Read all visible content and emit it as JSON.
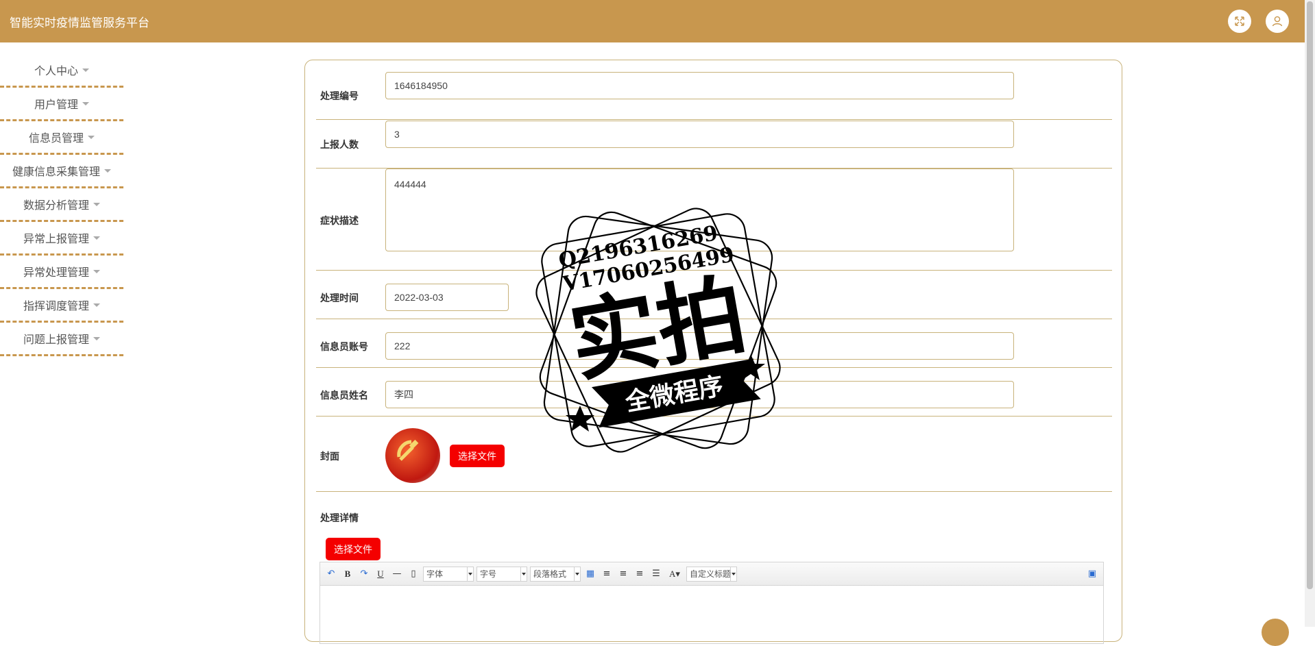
{
  "header": {
    "title": "智能实时疫情监管服务平台",
    "fullscreen_icon": "fullscreen-icon",
    "user_icon": "user-icon",
    "accent": "#c8974e"
  },
  "sidebar": {
    "items": [
      {
        "label": "个人中心"
      },
      {
        "label": "用户管理"
      },
      {
        "label": "信息员管理"
      },
      {
        "label": "健康信息采集管理"
      },
      {
        "label": "数据分析管理"
      },
      {
        "label": "异常上报管理"
      },
      {
        "label": "异常处理管理"
      },
      {
        "label": "指挥调度管理"
      },
      {
        "label": "问题上报管理"
      }
    ]
  },
  "form": {
    "process_no": {
      "label": "处理编号",
      "value": "1646184950"
    },
    "report_count": {
      "label": "上报人数",
      "value": "3"
    },
    "symptom": {
      "label": "症状描述",
      "value": "444444"
    },
    "process_time": {
      "label": "处理时间",
      "value": "2022-03-03"
    },
    "informant_account": {
      "label": "信息员账号",
      "value": "222"
    },
    "informant_name": {
      "label": "信息员姓名",
      "value": "李四"
    },
    "cover": {
      "label": "封面",
      "button": "选择文件"
    },
    "detail": {
      "label": "处理详情",
      "button": "选择文件"
    }
  },
  "editor": {
    "font_select": "字体",
    "size_select": "字号",
    "paragraph_select": "段落格式",
    "custom_title_select": "自定义标题",
    "font_color_label": "A"
  },
  "watermark": {
    "line1": "Q2196316269",
    "line2": "V17060256499",
    "main": "实拍",
    "ribbon": "全微程序"
  }
}
